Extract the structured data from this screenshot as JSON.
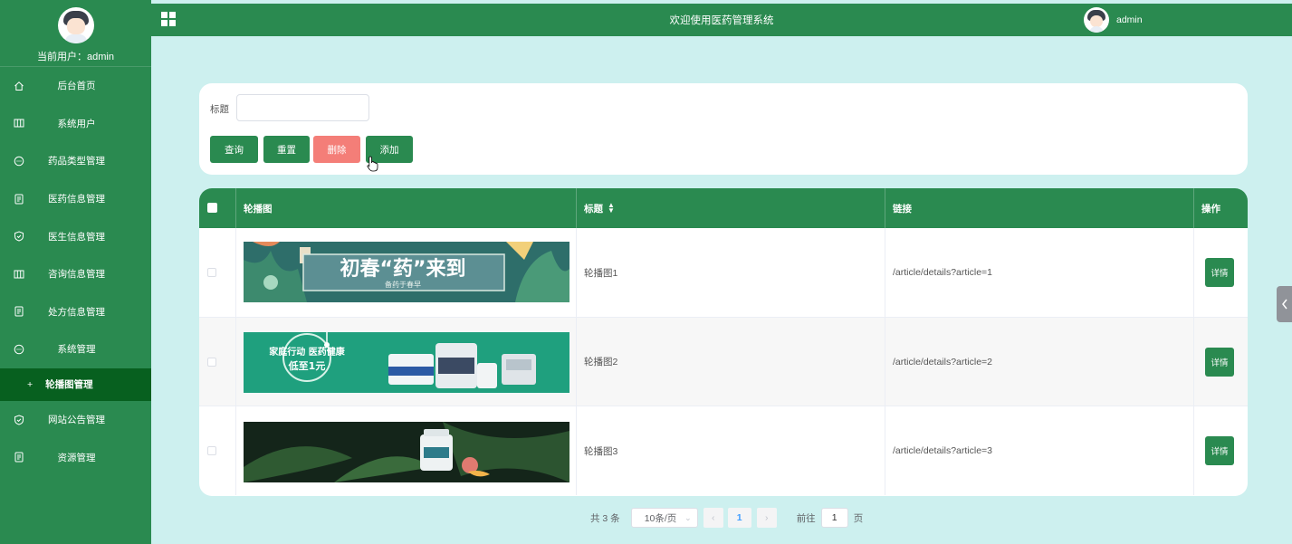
{
  "sidebar": {
    "current_user": "当前用户：admin",
    "items": [
      {
        "label": "后台首页",
        "icon": "home-icon"
      },
      {
        "label": "系统用户",
        "icon": "columns-icon"
      },
      {
        "label": "药品类型管理",
        "icon": "chat-icon"
      },
      {
        "label": "医药信息管理",
        "icon": "document-icon"
      },
      {
        "label": "医生信息管理",
        "icon": "shield-check-icon"
      },
      {
        "label": "咨询信息管理",
        "icon": "columns-icon"
      },
      {
        "label": "处方信息管理",
        "icon": "document-icon"
      },
      {
        "label": "系统管理",
        "icon": "chat-icon"
      }
    ],
    "active_sub": {
      "label": "轮播图管理",
      "icon": "plus-icon"
    },
    "items_after": [
      {
        "label": "网站公告管理",
        "icon": "shield-check-icon"
      },
      {
        "label": "资源管理",
        "icon": "document-icon"
      }
    ]
  },
  "topbar": {
    "title": "欢迎使用医药管理系统",
    "user": "admin"
  },
  "search": {
    "title_label": "标题",
    "title_value": "",
    "buttons": {
      "query": "查询",
      "reset": "重置",
      "delete": "删除",
      "add": "添加"
    }
  },
  "table": {
    "columns": [
      "轮播图",
      "标题",
      "链接",
      "操作"
    ],
    "sort_icon": "sort-icon",
    "rows": [
      {
        "title": "轮播图1",
        "link": "/article/details?article=1",
        "action": "详情",
        "banner": {
          "headline": "初春“药”来到",
          "sub": "备药于春早",
          "theme": "teal-leaves"
        }
      },
      {
        "title": "轮播图2",
        "link": "/article/details?article=2",
        "action": "详情",
        "banner": {
          "headline": "家庭行动 医药健康",
          "sub": "低至1元",
          "theme": "green-products"
        }
      },
      {
        "title": "轮播图3",
        "link": "/article/details?article=3",
        "action": "详情",
        "banner": {
          "headline": "",
          "sub": "",
          "theme": "dark-fern"
        }
      }
    ]
  },
  "pagination": {
    "total": "共 3 条",
    "page_size": "10条/页",
    "current_page": "1",
    "goto_label": "前往",
    "goto_value": "1",
    "unit": "页"
  },
  "colors": {
    "primary": "#2a8a50",
    "active_sub": "#07601f",
    "danger": "#f47e78",
    "background": "#cdf0ef"
  }
}
